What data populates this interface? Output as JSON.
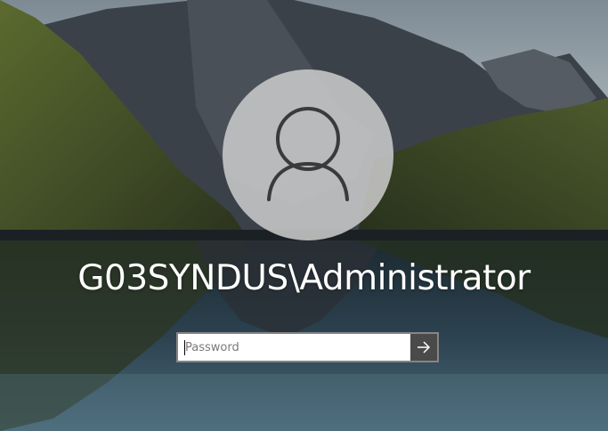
{
  "account": {
    "username": "G03SYNDUS\\Administrator"
  },
  "password_field": {
    "value": "",
    "placeholder": "Password"
  },
  "icons": {
    "avatar": "user-silhouette-icon",
    "submit": "arrow-right-icon"
  },
  "colors": {
    "avatar_circle": "#c8c8c8",
    "submit_button": "#4a4a4a",
    "text": "#ffffff"
  }
}
